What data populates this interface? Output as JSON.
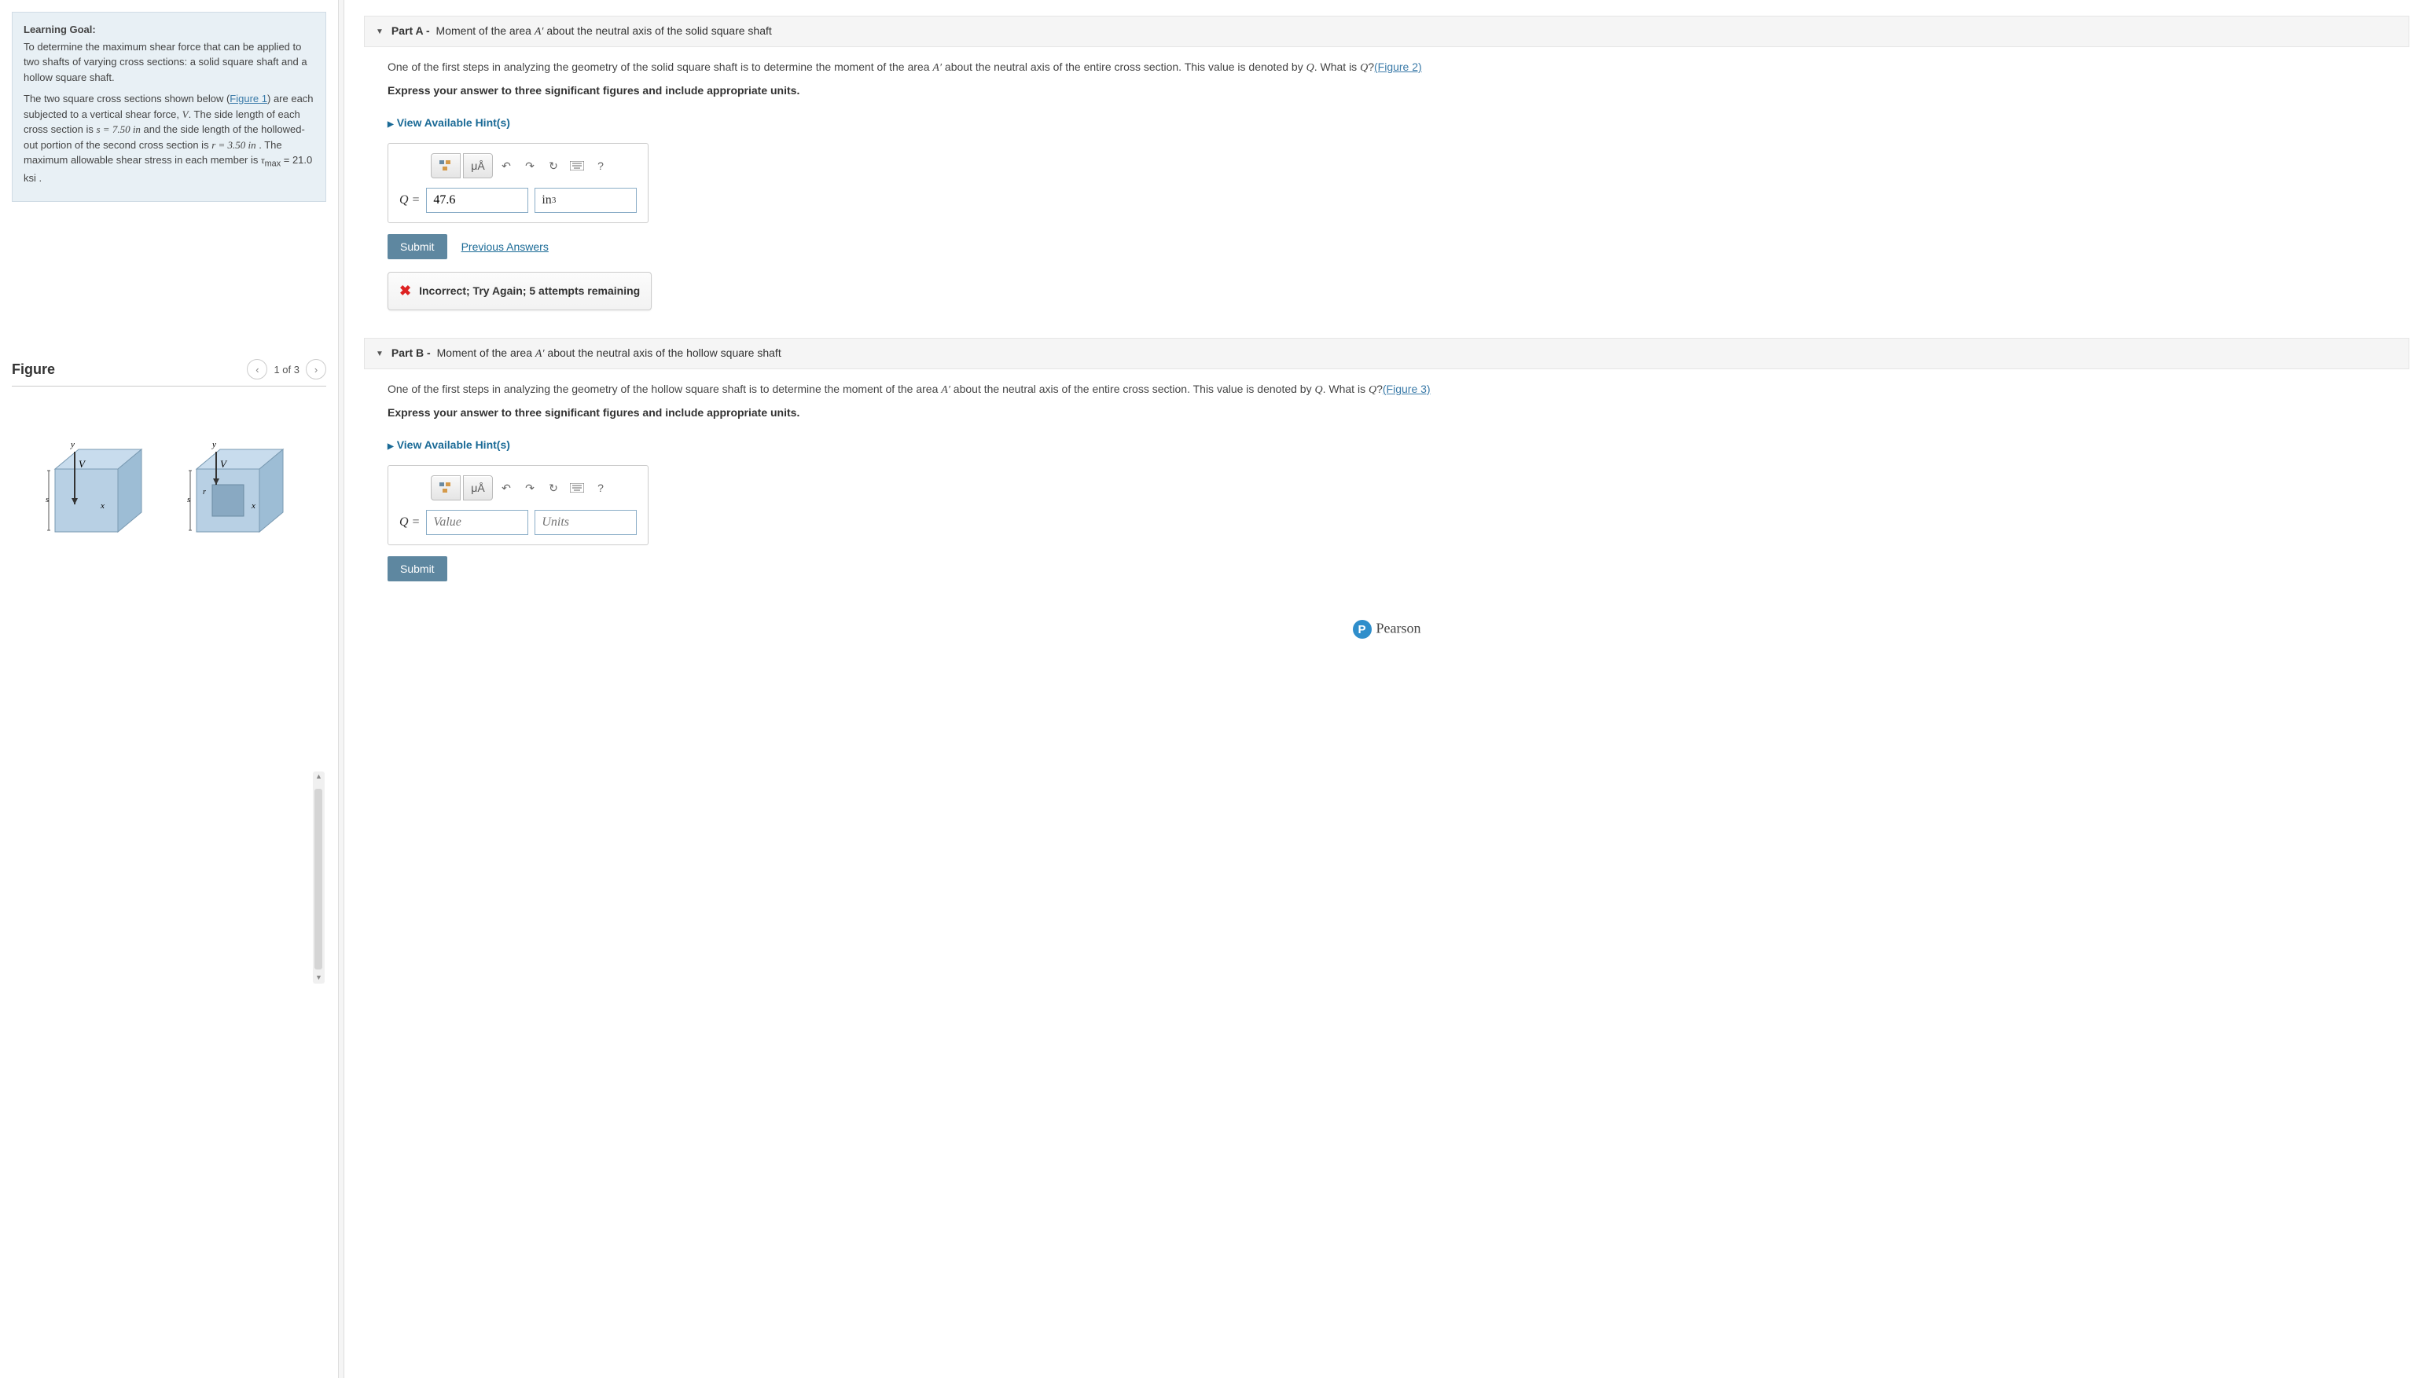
{
  "learning_goal": {
    "title": "Learning Goal:",
    "p1": "To determine the maximum shear force that can be applied to two shafts of varying cross sections: a solid square shaft and a hollow square shaft.",
    "p2_pre": "The two square cross sections shown below (",
    "p2_fig": "Figure 1",
    "p2_mid1": ") are each subjected to a vertical shear force, ",
    "p2_v": "V",
    "p2_mid2": ". The side length of each cross section is ",
    "p2_s": "s = 7.50 in",
    "p2_mid3": " and the side length of the hollowed-out portion of the second cross section is ",
    "p2_r": "r = 3.50 in",
    "p2_mid4": " . The maximum allowable shear stress in each member is ",
    "p2_tau": "τ",
    "p2_sub": "max",
    "p2_tail": " = 21.0 ksi ."
  },
  "figure": {
    "title": "Figure",
    "count": "1 of 3"
  },
  "partA": {
    "label": "Part A - ",
    "title_pre": "Moment of the area ",
    "title_a": "A′",
    "title_post": " about the neutral axis of the solid square shaft",
    "q_pre": "One of the first steps in analyzing the geometry of the solid square shaft is to determine the moment of the area ",
    "q_a": "A′",
    "q_mid": " about the neutral axis of the entire cross section. This value is denoted by ",
    "q_q": "Q",
    "q_mid2": ". What is ",
    "q_q2": "Q",
    "q_post": "?",
    "fig_link": "(Figure 2)",
    "instruction": "Express your answer to three significant figures and include appropriate units.",
    "hints": "View Available Hint(s)",
    "label_q": "Q = ",
    "value": "47.6",
    "units": "in",
    "units_sup": "3",
    "submit": "Submit",
    "prev": "Previous Answers",
    "feedback": "Incorrect; Try Again; 5 attempts remaining"
  },
  "partB": {
    "label": "Part B - ",
    "title_pre": "Moment of the area ",
    "title_a": "A′",
    "title_post": " about the neutral axis of the hollow square shaft",
    "q_pre": "One of the first steps in analyzing the geometry of the hollow square shaft is to determine the moment of the area ",
    "q_a": "A′",
    "q_mid": " about the neutral axis of the entire cross section. This value is denoted by ",
    "q_q": "Q",
    "q_mid2": ". What is ",
    "q_q2": "Q",
    "q_post": "?",
    "fig_link": "(Figure 3)",
    "instruction": "Express your answer to three significant figures and include appropriate units.",
    "hints": "View Available Hint(s)",
    "label_q": "Q = ",
    "value_ph": "Value",
    "units_ph": "Units",
    "submit": "Submit"
  },
  "tools": {
    "mu": "μÅ",
    "help": "?"
  },
  "footer": {
    "brand": "Pearson"
  }
}
